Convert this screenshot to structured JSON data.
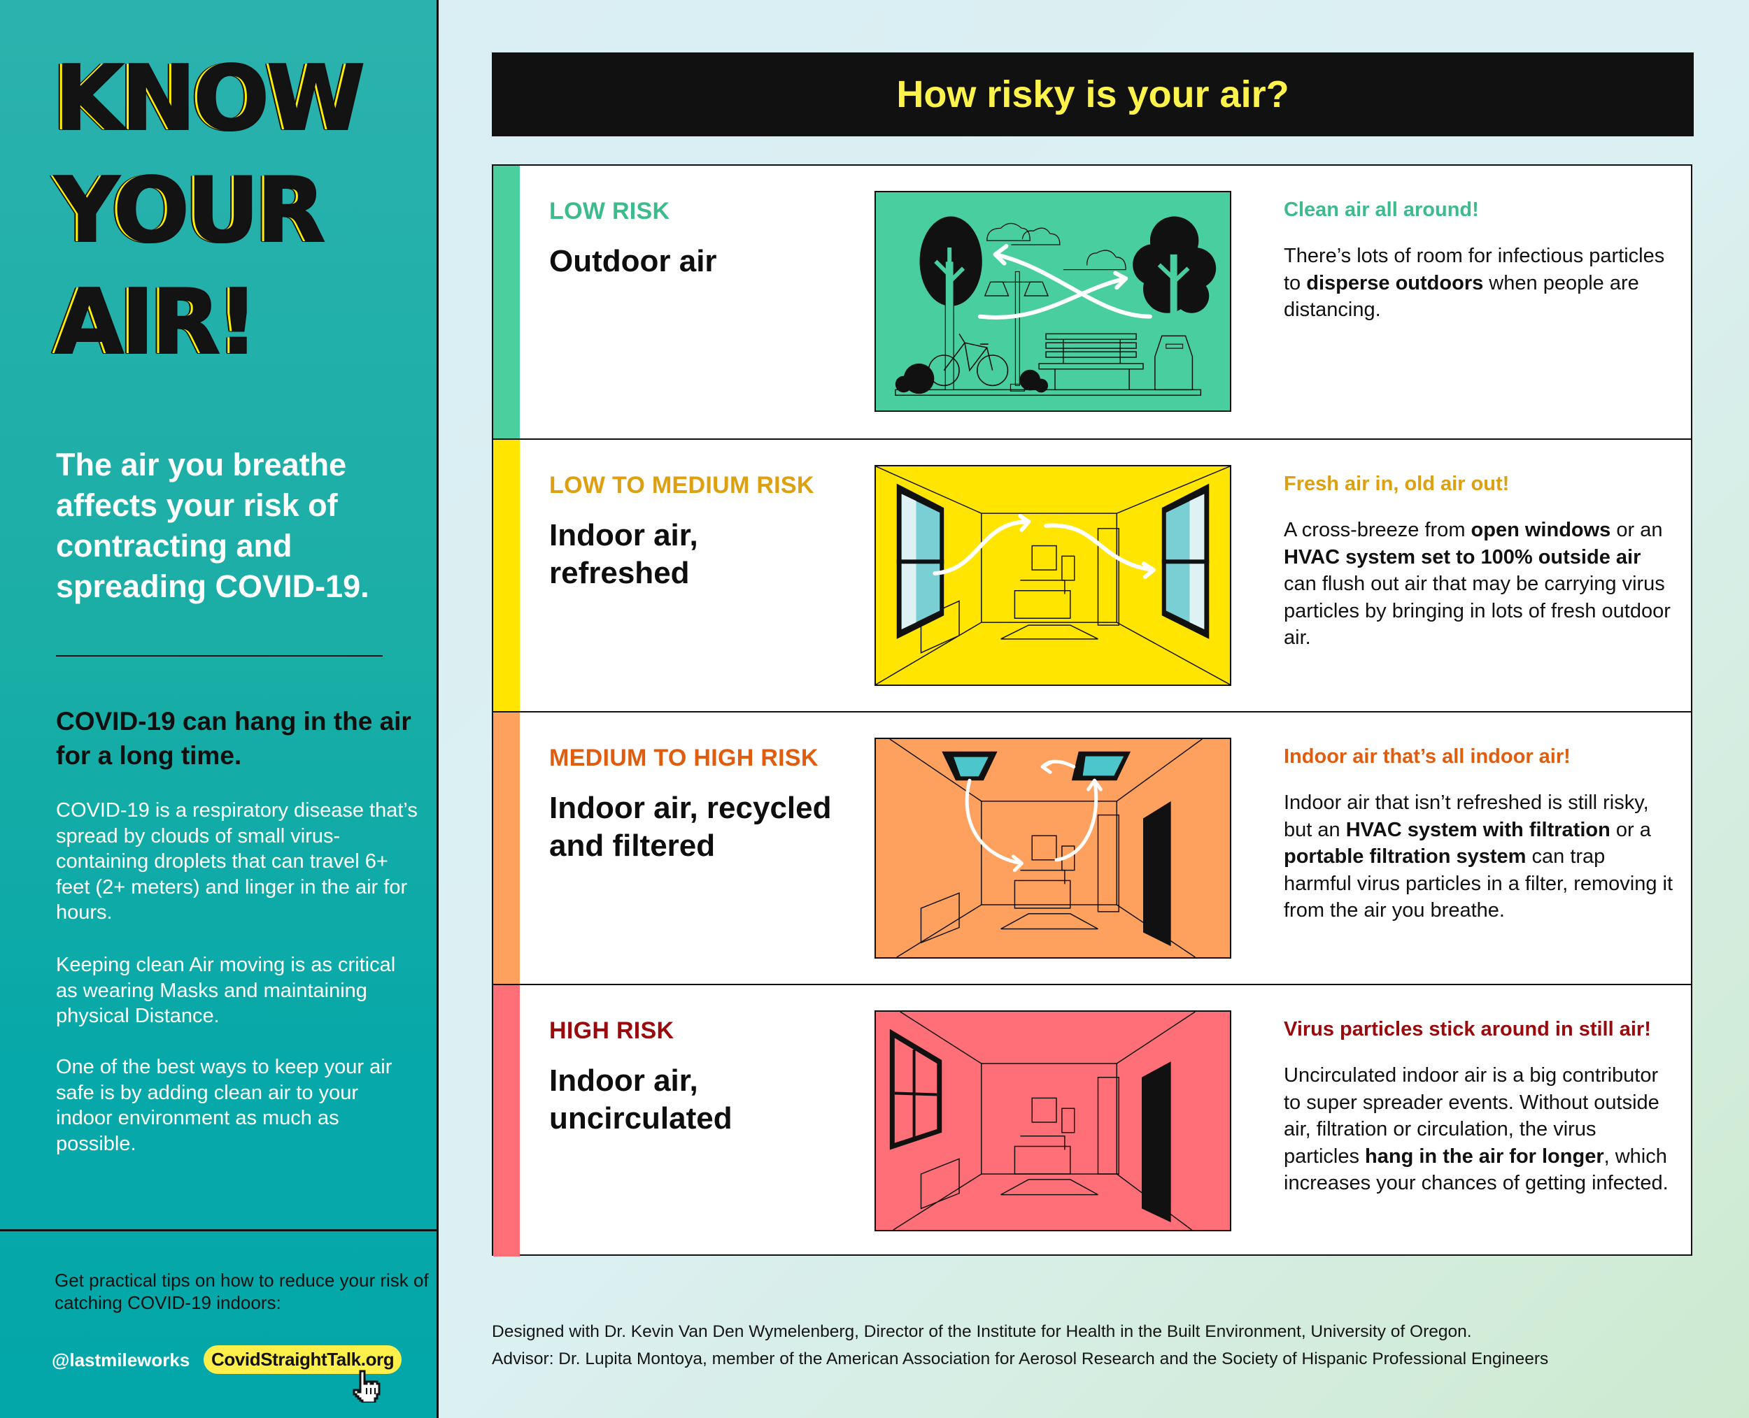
{
  "sidebar": {
    "title_lines": [
      "KNOW",
      "YOUR",
      "AIR!"
    ],
    "subtitle": "The air you breathe affects your risk of contracting and spreading COVID-19.",
    "hang_heading": "COVID-19 can hang in the air for a long time.",
    "body_paragraphs": [
      "COVID-19 is a respiratory disease that’s spread by clouds of small virus-containing droplets that can travel 6+ feet (2+ meters) and linger in the air for hours.",
      "Keeping clean Air moving is as critical as wearing Masks and maintaining physical Distance.",
      "One of the best ways to keep your air safe is by adding clean air to your indoor environment as much as possible."
    ],
    "tips_text": "Get practical tips on how to reduce your risk of catching COVID-19 indoors:",
    "handle": "@lastmileworks",
    "site_link": "CovidStraightTalk.org",
    "cursor_icon": "pointer-hand-icon"
  },
  "header": {
    "title": "How risky is your air?"
  },
  "risks": [
    {
      "level": "LOW RISK",
      "name": "Outdoor air",
      "color": "#4ccf9f",
      "text_color": "#3dbb8c",
      "image": "park-scene-illustration",
      "subheading": "Clean air all around!",
      "description": [
        {
          "t": "There’s lots of room for infectious particles to "
        },
        {
          "t": "disperse outdoors",
          "b": true
        },
        {
          "t": " when people are distancing."
        }
      ]
    },
    {
      "level": "LOW TO MEDIUM RISK",
      "name": "Indoor air, refreshed",
      "color": "#ffe500",
      "text_color": "#dca010",
      "image": "room-open-windows-illustration",
      "subheading": "Fresh air in, old air out!",
      "description": [
        {
          "t": "A cross-breeze from "
        },
        {
          "t": "open windows",
          "b": true
        },
        {
          "t": " or an "
        },
        {
          "t": "HVAC system set to 100% outside air",
          "b": true
        },
        {
          "t": " can flush out air that may be carrying virus particles by bringing in lots of fresh outdoor air."
        }
      ]
    },
    {
      "level": "MEDIUM TO HIGH RISK",
      "name": "Indoor air, recycled and filtered",
      "color": "#ffa15e",
      "text_color": "#e05d10",
      "image": "room-hvac-vents-illustration",
      "subheading": "Indoor air that’s all indoor air!",
      "description": [
        {
          "t": "Indoor air that isn’t refreshed is still risky, but an "
        },
        {
          "t": "HVAC system with filtration",
          "b": true
        },
        {
          "t": " or a "
        },
        {
          "t": "portable filtration system",
          "b": true
        },
        {
          "t": " can trap harmful virus particles in a filter, removing it from the air you breathe."
        }
      ]
    },
    {
      "level": "HIGH RISK",
      "name": "Indoor air, uncirculated",
      "color": "#ff6f78",
      "text_color": "#9a0a0d",
      "image": "room-closed-illustration",
      "subheading": "Virus particles stick around in still air!",
      "description": [
        {
          "t": "Uncirculated indoor air is a big contributor to super spreader events. Without outside air, filtration or circulation, the virus particles "
        },
        {
          "t": "hang in the air for longer",
          "b": true
        },
        {
          "t": ", which increases your chances of getting infected."
        }
      ]
    }
  ],
  "credits": [
    "Designed with Dr. Kevin Van Den Wymelenberg, Director of the Institute for Health in the Built Environment, University of Oregon.",
    "Advisor: Dr. Lupita Montoya, member of the American Association for Aerosol Research and the Society of Hispanic Professional Engineers"
  ]
}
